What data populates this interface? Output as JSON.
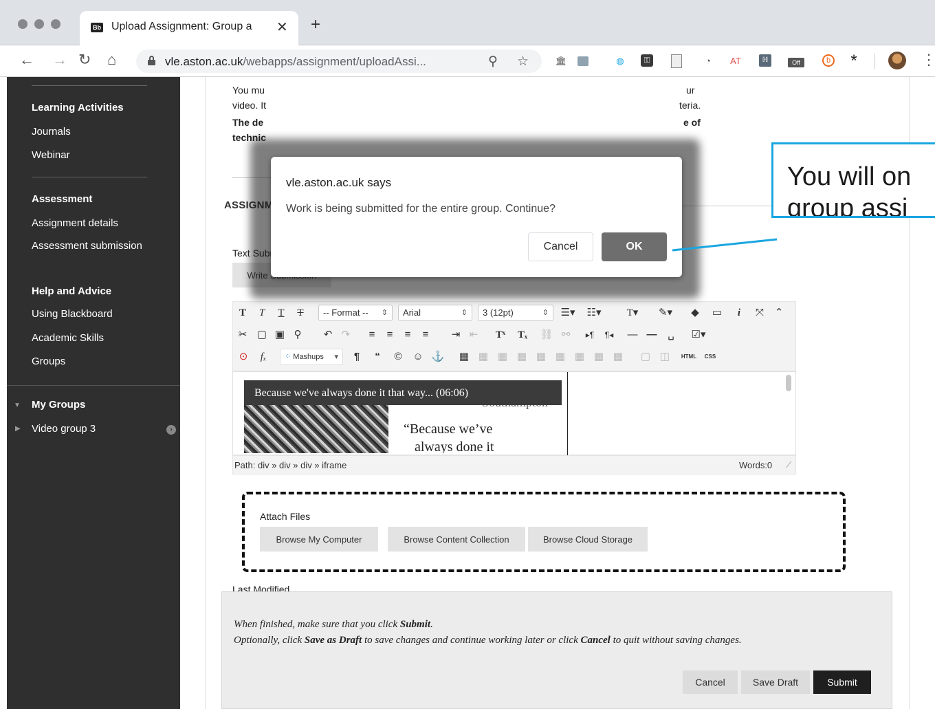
{
  "browser": {
    "tab_favicon": "Bb",
    "tab_title": "Upload Assignment: Group ass",
    "tab_close": "✕",
    "new_tab": "+",
    "url_host": "vle.aston.ac.uk",
    "url_path": "/webapps/assignment/uploadAssi...",
    "ext_at": "AT",
    "ext_off": "Off"
  },
  "sidebar": {
    "learning_heading": "Learning Activities",
    "learning_items": [
      "Journals",
      "Webinar"
    ],
    "assessment_heading": "Assessment",
    "assessment_items": [
      "Assignment details",
      "Assessment submission"
    ],
    "help_heading": "Help and Advice",
    "help_items": [
      "Using Blackboard",
      "Academic Skills",
      "Groups"
    ],
    "my_groups": "My Groups",
    "group_item": "Video group 3"
  },
  "content": {
    "intro_line1_a": "You mu",
    "intro_line1_b": "ur",
    "intro_line2_a": "video. It",
    "intro_line2_b": "teria.",
    "intro_line3_a": "The de",
    "intro_line3_b": "e of",
    "intro_line4": "technic",
    "section_title": "ASSIGNMENT SUBMISSION",
    "text_submission_label": "Text Submission",
    "write_submission": "Write Submission"
  },
  "editor": {
    "format_select": "-- Format --",
    "font_select": "Arial",
    "size_select": "3 (12pt)",
    "mashups": "Mashups",
    "video_title": "Because we've always done it that way... (06:06)",
    "video_quote_1": "“Because we’ve",
    "video_quote_2": "always done it",
    "video_univ": "Southampton",
    "path": "Path: div » div » div » iframe",
    "words": "Words:0"
  },
  "attach": {
    "label": "Attach Files",
    "browse_computer": "Browse My Computer",
    "browse_content": "Browse Content Collection",
    "browse_cloud": "Browse Cloud Storage"
  },
  "footer": {
    "last_modified": "Last Modified",
    "line1_pre": "When finished, make sure that you click ",
    "line1_bold": "Submit",
    "line1_post": ".",
    "line2_pre": "Optionally, click ",
    "line2_bold1": "Save as Draft",
    "line2_mid": " to save changes and continue working later or click ",
    "line2_bold2": "Cancel",
    "line2_post": " to quit without saving changes.",
    "cancel": "Cancel",
    "save_draft": "Save Draft",
    "submit": "Submit"
  },
  "dialog": {
    "title": "vle.aston.ac.uk says",
    "message": "Work is being submitted for the entire group. Continue?",
    "cancel": "Cancel",
    "ok": "OK"
  },
  "callout": {
    "line1": "You will on",
    "line2": "group assi"
  },
  "colors": {
    "sidebar_bg": "#2f2f2f",
    "callout_border": "#1aa6e0",
    "ok_button": "#6e6e6e",
    "submit_button": "#1f1f1f"
  }
}
